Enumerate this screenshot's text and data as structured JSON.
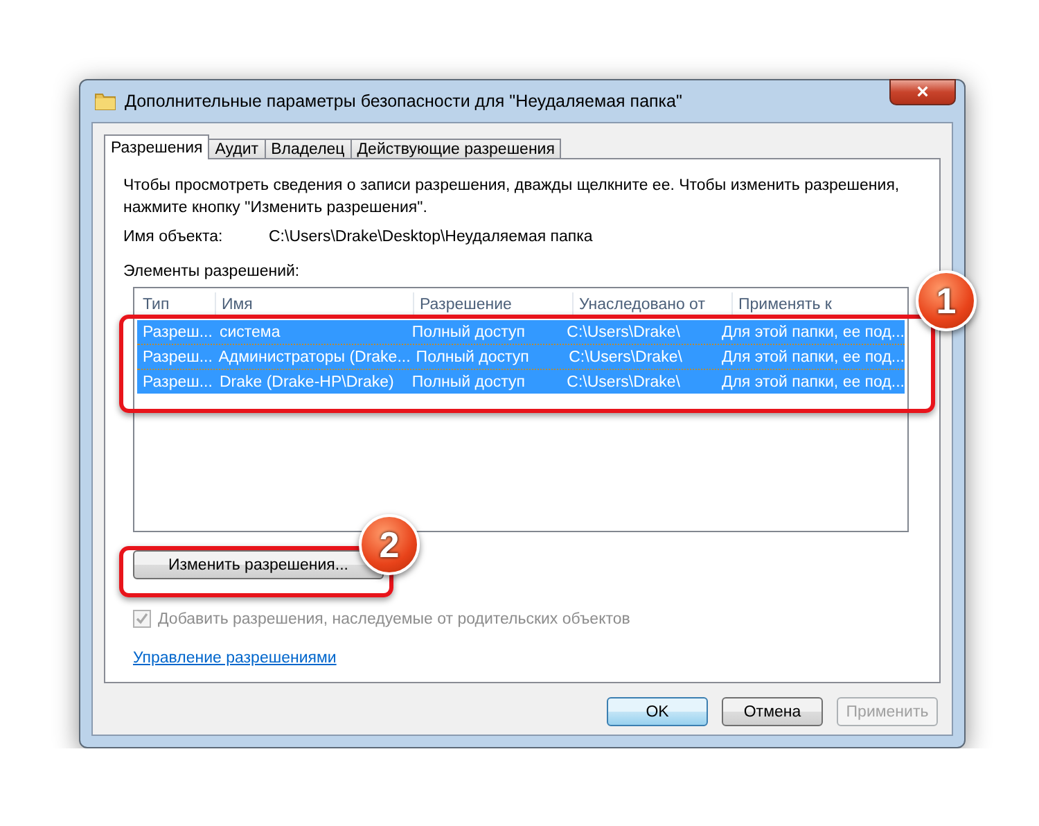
{
  "window": {
    "title": "Дополнительные параметры безопасности  для \"Неудаляемая папка\"",
    "close": "×"
  },
  "tabs": [
    {
      "label": "Разрешения",
      "selected": true
    },
    {
      "label": "Аудит",
      "selected": false
    },
    {
      "label": "Владелец",
      "selected": false
    },
    {
      "label": "Действующие разрешения",
      "selected": false
    }
  ],
  "intro": "Чтобы просмотреть сведения о записи разрешения, дважды щелкните ее. Чтобы изменить разрешения, нажмите кнопку \"Изменить разрешения\".",
  "object_name": {
    "label": "Имя объекта:",
    "value": "C:\\Users\\Drake\\Desktop\\Неудаляемая папка"
  },
  "list_label": "Элементы разрешений:",
  "table": {
    "columns": [
      "Тип",
      "Имя",
      "Разрешение",
      "Унаследовано от",
      "Применять к"
    ],
    "rows": [
      {
        "cells": [
          "Разреш...",
          "система",
          "Полный доступ",
          "C:\\Users\\Drake\\",
          "Для этой папки, ее под..."
        ],
        "selected": true
      },
      {
        "cells": [
          "Разреш...",
          "Администраторы (Drake...",
          "Полный доступ",
          "C:\\Users\\Drake\\",
          "Для этой папки, ее под..."
        ],
        "selected": true
      },
      {
        "cells": [
          "Разреш...",
          "Drake (Drake-HP\\Drake)",
          "Полный доступ",
          "C:\\Users\\Drake\\",
          "Для этой папки, ее под..."
        ],
        "selected": true
      }
    ]
  },
  "change_button": {
    "label": "Изменить разрешения..."
  },
  "inherit_checkbox": {
    "label": "Добавить разрешения, наследуемые от родительских объектов",
    "checked": true,
    "disabled": true
  },
  "manage_link": "Управление разрешениями",
  "buttons": [
    {
      "label": "OK",
      "default": true,
      "disabled": false
    },
    {
      "label": "Отмена",
      "default": false,
      "disabled": false
    },
    {
      "label": "Применить",
      "default": false,
      "disabled": true
    }
  ],
  "callouts": [
    {
      "number": "1",
      "kind": "rows"
    },
    {
      "number": "2",
      "kind": "button"
    }
  ]
}
